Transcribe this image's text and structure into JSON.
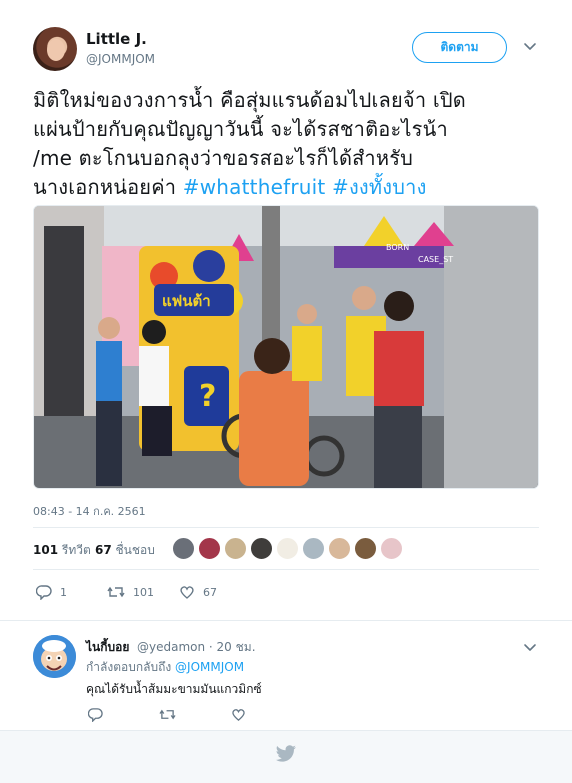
{
  "tweet": {
    "display_name": "Little J.",
    "username": "@JOMMJOM",
    "follow_label": "ติดตาม",
    "text_lines": [
      "มิติใหม่ของวงการน้ำ คือสุ่มแรนด้อมไปเลยจ้า เปิด",
      "แผ่นป้ายกับคุณปัญญาวันนี้ จะได้รสชาติอะไรน้า",
      "/me ตะโกนบอกลุงว่าขอรสอะไรก็ได้สำหรับ",
      "นางเอกหน่อยค่า "
    ],
    "hashtags": [
      "#whatthefruit",
      "#งงทั้งบาง"
    ],
    "timestamp": "08:43 - 14 ก.ค. 2561",
    "retweets_count": "101",
    "retweets_label": "รีทวีต",
    "likes_count": "67",
    "likes_label": "ชื่นชอบ",
    "actions": {
      "reply_count": "1",
      "retweet_count": "101",
      "like_count": "67"
    }
  },
  "photo": {
    "sign_text": "แฟนต้า",
    "booth_label": "BORN",
    "booth_label2": "CASE_ST"
  },
  "reply": {
    "display_name": "ไนกี้บอย",
    "username": "@yedamon",
    "time": "· 20 ชม.",
    "replying_prefix": "กำลังตอบกลับถึง",
    "replying_to": "@JOMMJOM",
    "text": "คุณได้รับน้ำส้มมะขามมันแกวมิกซ์"
  },
  "colors": {
    "accent": "#1da1f2",
    "secondary_text": "#657786",
    "footer_bg": "#f5f8fa"
  },
  "icons": [
    "chevron-down-icon",
    "reply-icon",
    "retweet-icon",
    "heart-icon",
    "twitter-bird-icon"
  ]
}
